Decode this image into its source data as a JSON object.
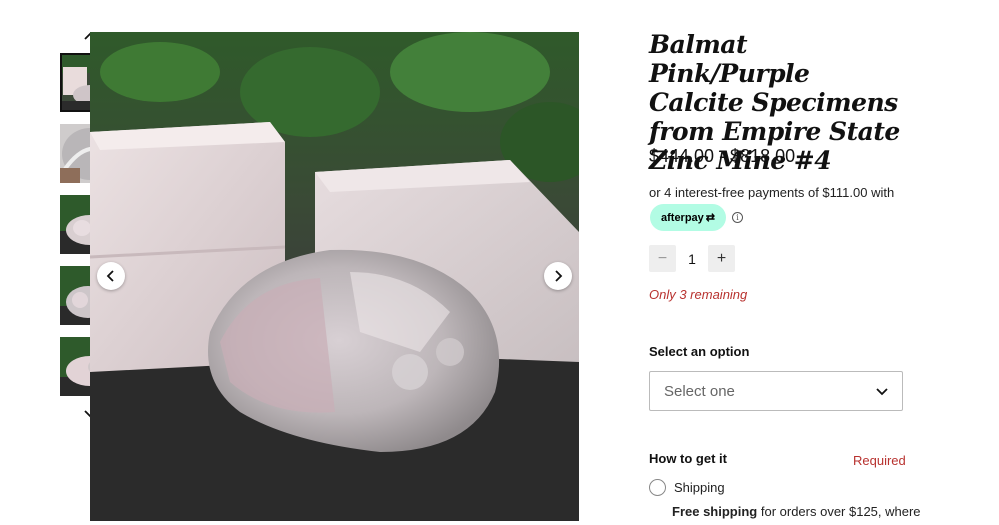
{
  "gallery": {
    "thumbnails": [
      {
        "alt": "thumbnail 1"
      },
      {
        "alt": "thumbnail 2"
      },
      {
        "alt": "thumbnail 3"
      },
      {
        "alt": "thumbnail 4"
      },
      {
        "alt": "thumbnail 5"
      }
    ],
    "active_index": 0
  },
  "product": {
    "title": "Balmat Pink/Purple Calcite Specimens from Empire State Zinc Mine #4",
    "price_range": "$444.00 - $818.00",
    "afterpay_text": "or 4 interest-free payments of $111.00 with",
    "afterpay_label": "afterpay",
    "afterpay_arrow": "⇄",
    "info_symbol": "i",
    "quantity": "1",
    "qty_minus": "−",
    "qty_plus": "+",
    "stock_text": "Only 3 remaining",
    "option_label": "Select an option",
    "select_placeholder": "Select one",
    "howto_label": "How to get it",
    "required_text": "Required",
    "shipping_label": "Shipping",
    "free_shipping_bold": "Free shipping",
    "free_shipping_rest": " for orders over $125, where"
  },
  "colors": {
    "afterpay_mint": "#b2fce4",
    "alert_red": "#b8322f"
  }
}
